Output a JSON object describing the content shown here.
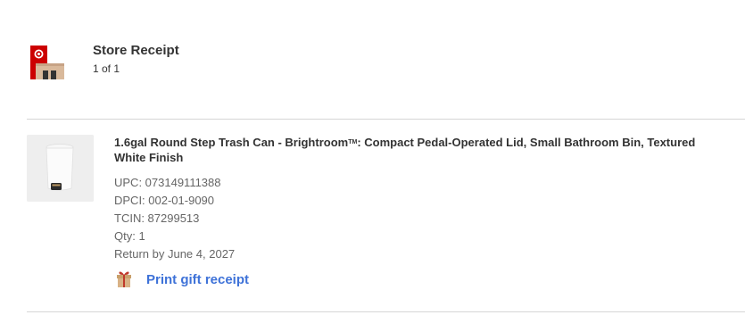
{
  "header": {
    "title": "Store Receipt",
    "count": "1 of 1"
  },
  "item": {
    "title_main": "1.6gal Round Step Trash Can - Brightroom",
    "title_tm": "TM",
    "title_rest": ": Compact Pedal-Operated Lid, Small Bathroom Bin, Textured White Finish",
    "upc": "UPC: 073149111388",
    "dpci": "DPCI: 002-01-9090",
    "tcin": "TCIN: 87299513",
    "qty": "Qty: 1",
    "return_by": "Return by June 4, 2027",
    "thumbnail_icon": "trash-can-product-image"
  },
  "actions": {
    "print_gift_receipt": "Print gift receipt",
    "gift_icon": "gift-icon"
  },
  "colors": {
    "brand_red": "#cc0000",
    "link_blue": "#3e72d8",
    "divider": "#d6d6d6",
    "muted_text": "#666666"
  }
}
